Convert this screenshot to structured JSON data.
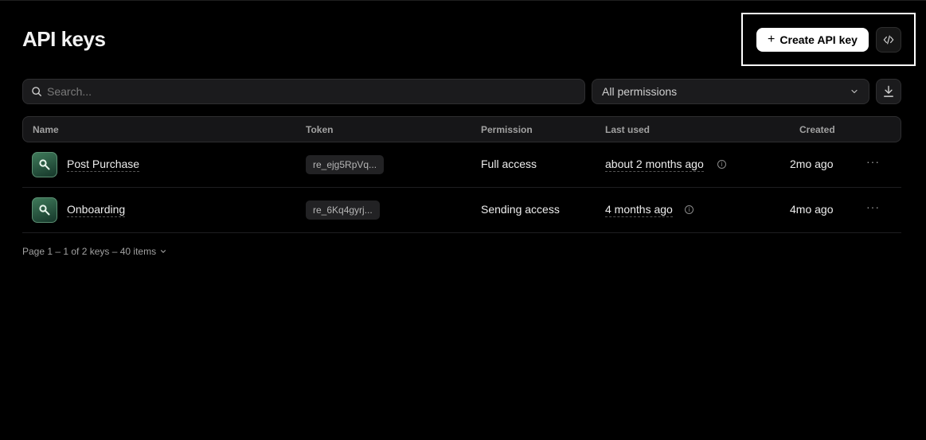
{
  "header": {
    "title": "API keys",
    "create_button": {
      "icon": "plus-icon",
      "label": "Create API key"
    },
    "code_button_icon": "code-icon"
  },
  "filters": {
    "search": {
      "placeholder": "Search...",
      "value": "",
      "icon": "search-icon"
    },
    "permission_select": {
      "selected": "All permissions",
      "icon": "chevron-down-icon"
    },
    "export_icon": "download-icon"
  },
  "table": {
    "columns": [
      "Name",
      "Token",
      "Permission",
      "Last used",
      "Created"
    ],
    "rows": [
      {
        "icon": "key-icon",
        "name": "Post Purchase",
        "token": "re_ejg5RpVq...",
        "permission": "Full access",
        "last_used": "about 2 months ago",
        "created": "2mo ago",
        "more": "···"
      },
      {
        "icon": "key-icon",
        "name": "Onboarding",
        "token": "re_6Kq4gyrj...",
        "permission": "Sending access",
        "last_used": "4 months ago",
        "created": "4mo ago",
        "more": "···"
      }
    ]
  },
  "pagination": {
    "summary": "Page 1 – 1 of 2 keys – 40 items"
  },
  "colors": {
    "background": "#000000",
    "accent_button": "#ffffff",
    "key_avatar": "#2f6a4a"
  }
}
